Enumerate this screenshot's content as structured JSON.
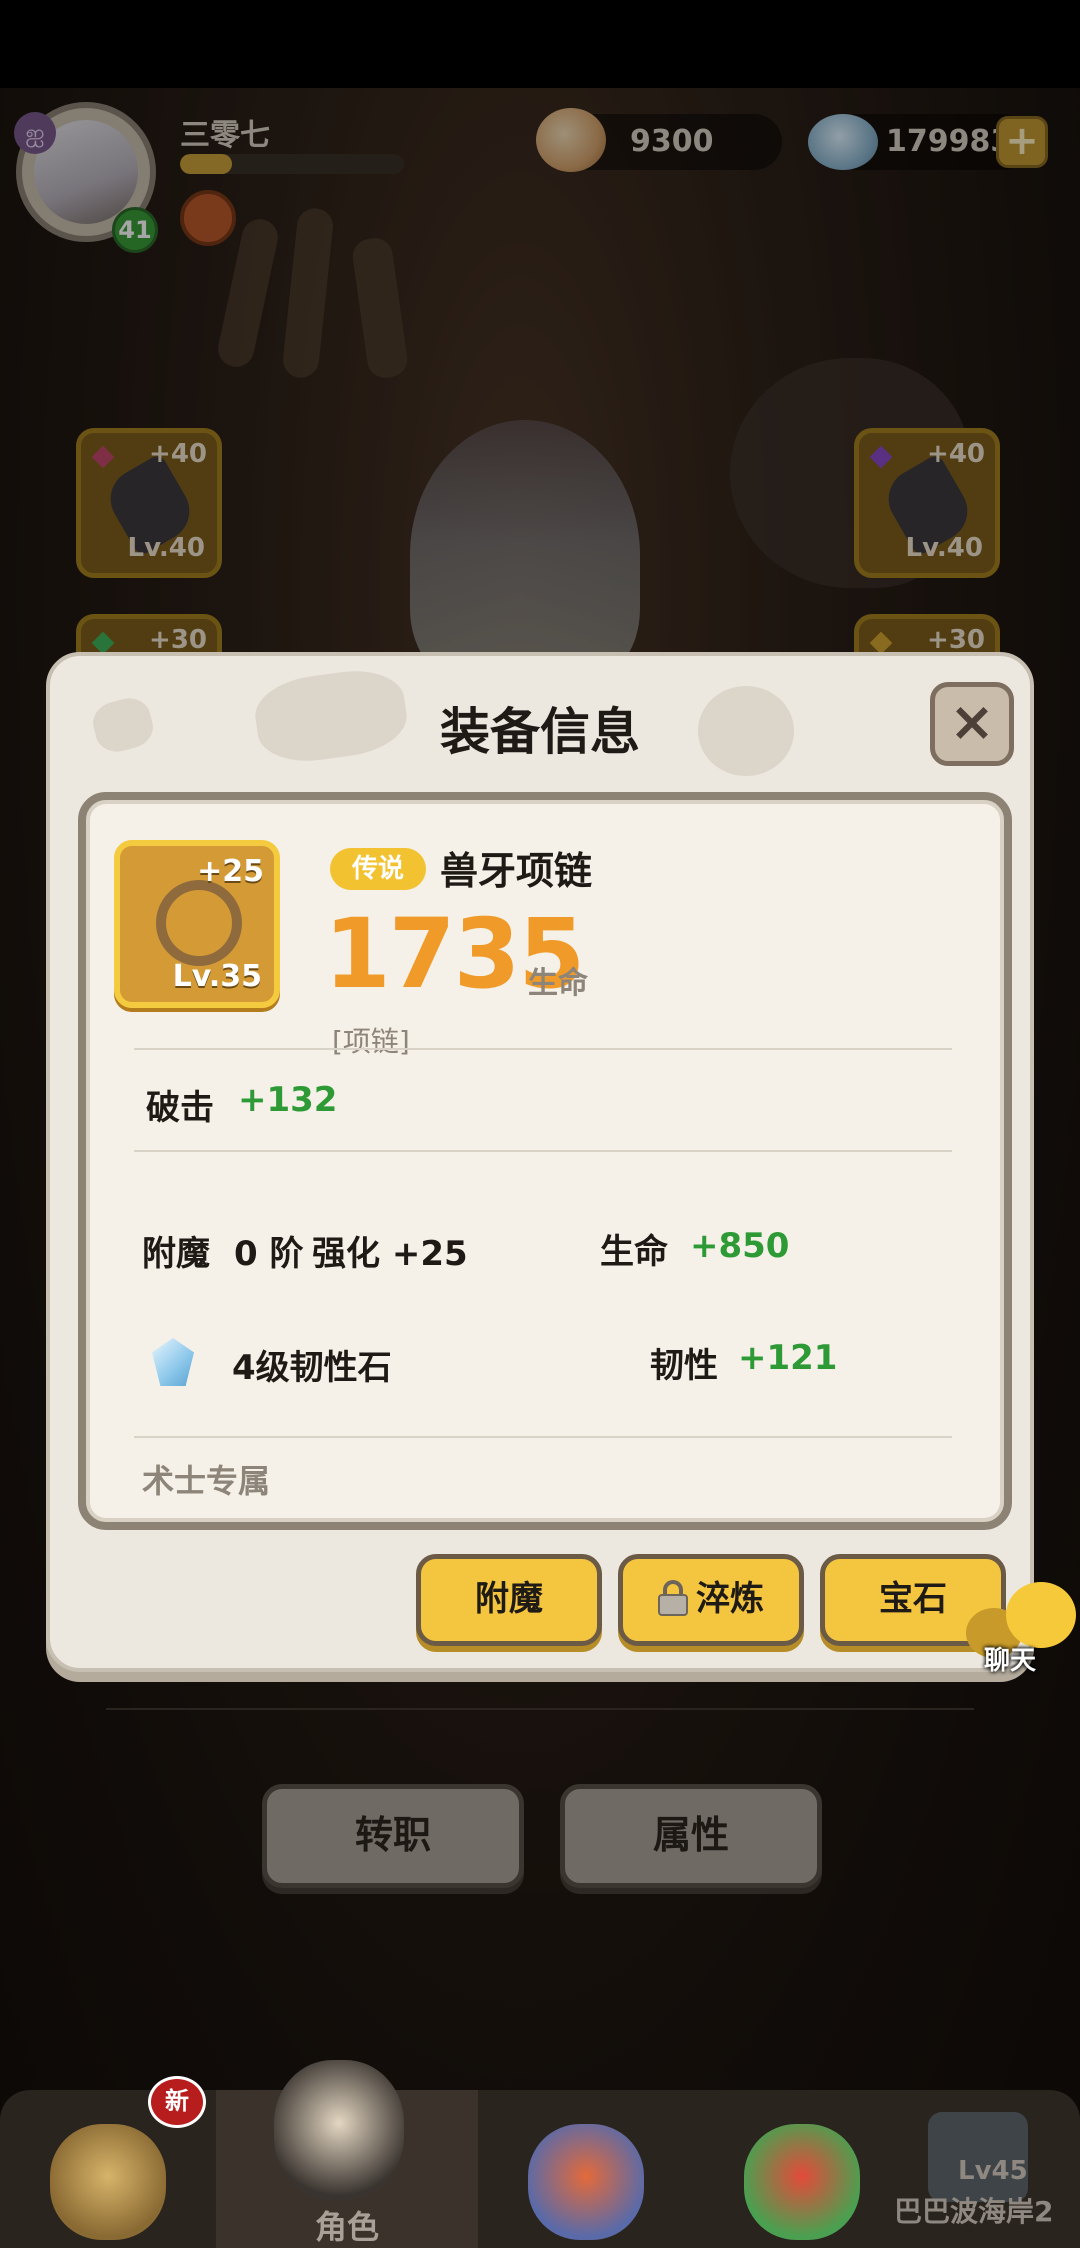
{
  "player": {
    "name": "三零七",
    "level": "41",
    "exp_fraction": 0.23
  },
  "resources": {
    "shells": "9300",
    "pearls": "179983"
  },
  "slots": [
    {
      "plus": "+40",
      "lv": "Lv.40"
    },
    {
      "plus": "+40",
      "lv": "Lv.40"
    },
    {
      "plus": "+30"
    },
    {
      "plus": "+30"
    }
  ],
  "dialog": {
    "title": "装备信息",
    "close": "×",
    "item": {
      "rarity": "传说",
      "name": "兽牙项链",
      "power": "1735",
      "power_label": "生命",
      "type": "[项链]",
      "plus": "+25",
      "lv": "Lv.35"
    },
    "crit": {
      "label": "破击",
      "value": "+132"
    },
    "enchant": {
      "label": "附魔",
      "tier": "0 阶",
      "enhance": "强化 +25"
    },
    "hp": {
      "label": "生命",
      "value": "+850"
    },
    "gem": {
      "name": "4级韧性石"
    },
    "toughness": {
      "label": "韧性",
      "value": "+121"
    },
    "exclusive": "术士专属",
    "buttons": {
      "enchant": "附魔",
      "temper": "淬炼",
      "gem": "宝石"
    }
  },
  "chat": {
    "label": "聊天"
  },
  "bottom_buttons": {
    "job_change": "转职",
    "attributes": "属性"
  },
  "nav": {
    "new_badge": "新",
    "role_label": "角色",
    "locked_level": "Lv45",
    "locked_name": "巴巴波海岸2"
  },
  "colors": {
    "accent_orange": "#f09a2a",
    "stat_green": "#2d9a36",
    "gold": "#f4c53e"
  }
}
